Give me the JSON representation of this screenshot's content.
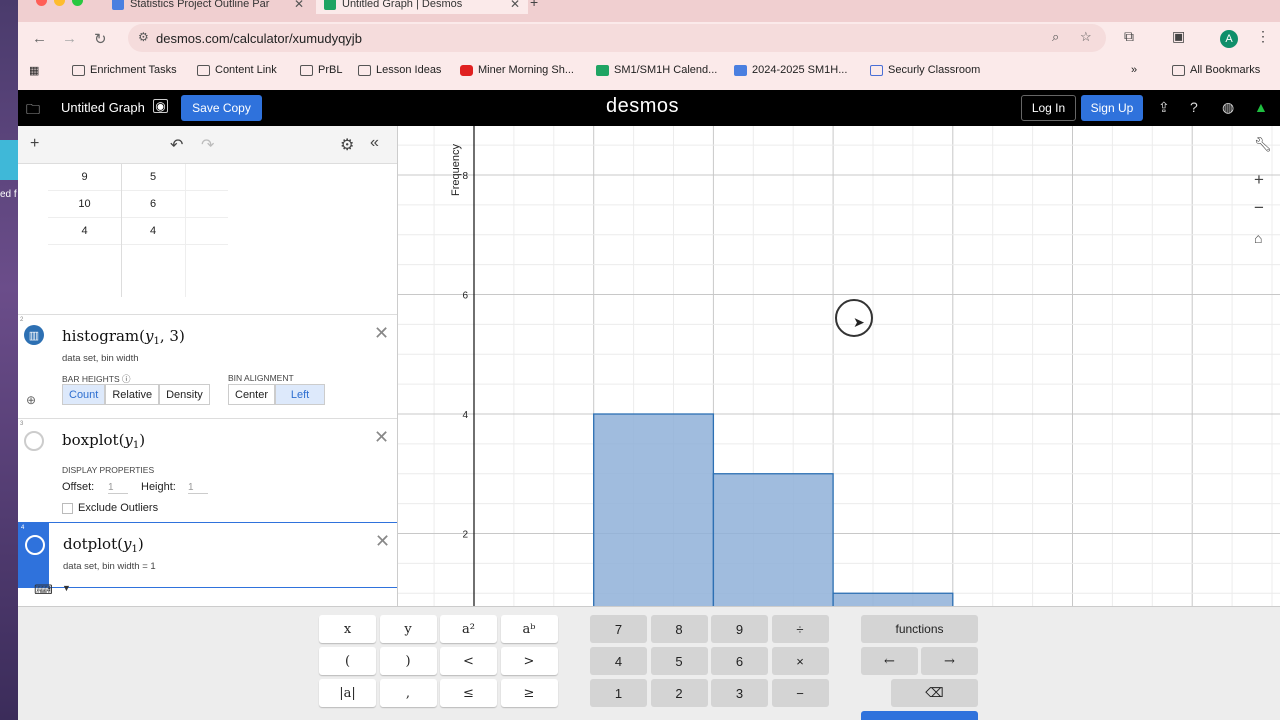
{
  "browser": {
    "tabs": [
      {
        "title": "Statistics Project Outline Par",
        "favicon_color": "#4a7fe0"
      },
      {
        "title": "Untitled Graph | Desmos",
        "favicon_color": "#1fa463"
      }
    ],
    "url": "desmos.com/calculator/xumudyqyjb",
    "bookmarks": [
      "Enrichment Tasks",
      "Content Link",
      "PrBL",
      "Lesson Ideas",
      "Miner Morning Sh...",
      "SM1/SM1H Calend...",
      "2024-2025 SM1H...",
      "Securly Classroom",
      "All Bookmarks"
    ],
    "avatar_letter": "A",
    "left_edge_fragment": "ed f"
  },
  "desmos": {
    "graph_title": "Untitled Graph",
    "save_copy": "Save Copy",
    "logo": "desmos",
    "login": "Log In",
    "signup": "Sign Up"
  },
  "table": {
    "rows": [
      {
        "x": "9",
        "y": "5"
      },
      {
        "x": "10",
        "y": "6"
      },
      {
        "x": "4",
        "y": "4"
      }
    ]
  },
  "expressions": {
    "histogram": {
      "number": "2",
      "fn": "histogram",
      "var": "y",
      "var_sub": "1",
      "arg": "3",
      "meta": "data set, bin width",
      "bar_heights_label": "BAR HEIGHTS",
      "bar_heights_options": [
        "Count",
        "Relative",
        "Density"
      ],
      "bar_heights_selected": "Count",
      "bin_alignment_label": "BIN ALIGNMENT",
      "bin_alignment_options": [
        "Center",
        "Left"
      ],
      "bin_alignment_selected": "Left"
    },
    "boxplot": {
      "number": "3",
      "fn": "boxplot",
      "var": "y",
      "var_sub": "1",
      "display_label": "DISPLAY PROPERTIES",
      "offset_label": "Offset:",
      "offset_value": "1",
      "height_label": "Height:",
      "height_value": "1",
      "exclude_label": "Exclude Outliers"
    },
    "dotplot": {
      "number": "4",
      "fn": "dotplot",
      "var": "y",
      "var_sub": "1",
      "meta": "data set, bin width = 1"
    }
  },
  "chart_data": {
    "type": "bar",
    "ylabel": "Frequency",
    "y_ticks": [
      "2",
      "4",
      "6",
      "8"
    ],
    "bars": [
      {
        "x0": 3,
        "x1": 6,
        "value": 4
      },
      {
        "x0": 6,
        "x1": 9,
        "value": 3
      },
      {
        "x0": 9,
        "x1": 12,
        "value": 1
      }
    ],
    "fill": "#8fb0d8",
    "stroke": "#2d70b3",
    "grid": true
  },
  "keypad": {
    "left": [
      "x",
      "y",
      "a²",
      "aᵇ",
      "(",
      ")",
      "<",
      ">",
      "|a|",
      ",",
      "≤",
      "≥"
    ],
    "middle": [
      "7",
      "8",
      "9",
      "÷",
      "4",
      "5",
      "6",
      "×",
      "1",
      "2",
      "3",
      "−"
    ],
    "functions": "functions",
    "left_arrow": "←",
    "right_arrow": "→",
    "backspace": "⌫"
  }
}
